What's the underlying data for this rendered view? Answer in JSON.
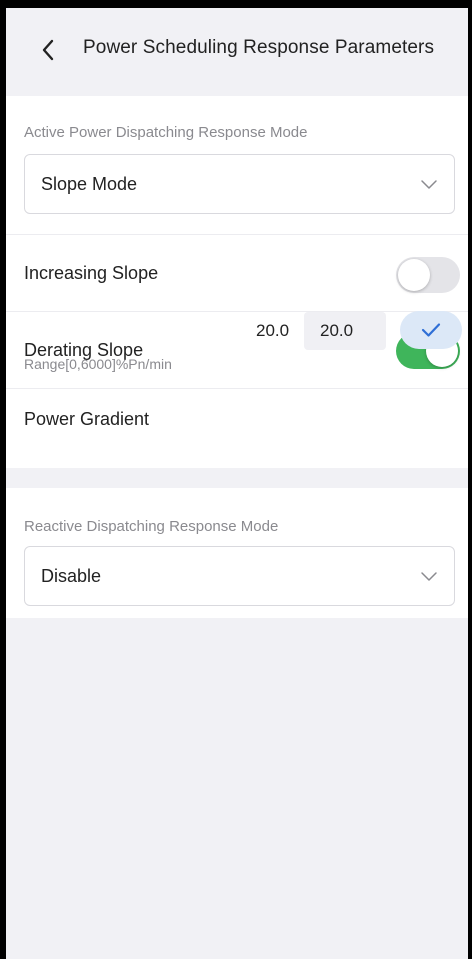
{
  "header": {
    "title": "Power Scheduling Response Parameters",
    "back_icon": "chevron-left-icon"
  },
  "active_mode": {
    "caption": "Active Power Dispatching Response Mode",
    "selected": "Slope Mode",
    "chevron_icon": "chevron-down-icon"
  },
  "increasing_slope": {
    "label": "Increasing Slope",
    "enabled": false
  },
  "derating_slope": {
    "label": "Derating Slope",
    "enabled": true
  },
  "power_gradient": {
    "label": "Power Gradient",
    "current_value": "20.0",
    "input_value": "20.0",
    "range": "Range[0,6000]%Pn/min",
    "confirm_icon": "check-icon"
  },
  "reactive_mode": {
    "caption": "Reactive Dispatching Response Mode",
    "selected": "Disable",
    "chevron_icon": "chevron-down-icon"
  },
  "colors": {
    "toggle_on": "#3fb55b",
    "toggle_off": "#e4e4e8",
    "accent_blue": "#2f6fd6",
    "confirm_bg": "#dce8f7",
    "page_bg": "#f1f1f5"
  }
}
